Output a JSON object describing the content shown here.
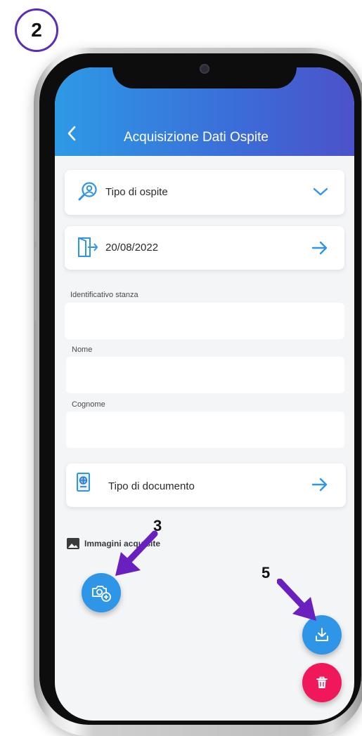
{
  "step_badge": "2",
  "header": {
    "title": "Acquisizione Dati Ospite"
  },
  "guest_type": {
    "label": "Tipo di ospite"
  },
  "date_card": {
    "value": "20/08/2022"
  },
  "fields": {
    "room_label": "Identificativo stanza",
    "name_label": "Nome",
    "surname_label": "Cognome",
    "room_value": "",
    "name_value": "",
    "surname_value": ""
  },
  "document_card": {
    "label": "Tipo di documento"
  },
  "images_section": {
    "label": "Immagini acquisite"
  },
  "annotations": {
    "camera_step": "3",
    "download_step": "5"
  },
  "colors": {
    "accent": "#2f95e6",
    "header_start": "#2d9ae5",
    "header_end": "#4c52c9",
    "delete": "#f0185a",
    "annotation": "#6a1fbf"
  },
  "icons": {
    "back": "chevron-left-icon",
    "guest_type": "user-search-icon",
    "guest_type_action": "chevron-down-icon",
    "date": "door-exit-icon",
    "date_action": "arrow-right-icon",
    "document": "passport-icon",
    "document_action": "arrow-right-icon",
    "images": "image-icon",
    "camera": "camera-add-icon",
    "download": "download-icon",
    "delete": "trash-icon"
  }
}
